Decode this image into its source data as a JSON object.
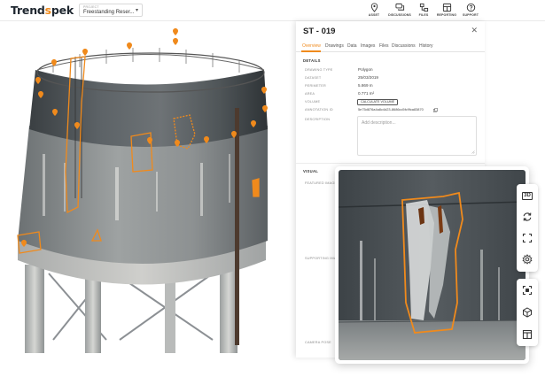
{
  "header": {
    "logo_main": "Trend",
    "logo_accent": "s",
    "logo_tail": "pek",
    "project_caption": "PROJECT",
    "project_value": "Freestanding Reser...",
    "nav": [
      {
        "label": "ASSET",
        "icon": "map-pin-icon"
      },
      {
        "label": "DISCUSSIONS",
        "icon": "chat-icon"
      },
      {
        "label": "FILES",
        "icon": "files-icon"
      },
      {
        "label": "REPORTING",
        "icon": "report-icon"
      },
      {
        "label": "SUPPORT",
        "icon": "help-icon"
      }
    ]
  },
  "panel": {
    "title": "ST - 019",
    "tabs": [
      "Overview",
      "Drawings",
      "Data",
      "Images",
      "Files",
      "Discussions",
      "History"
    ],
    "active_tab": "Overview",
    "details_heading": "DETAILS",
    "rows": [
      {
        "key": "DRAWING TYPE",
        "value": "Polygon"
      },
      {
        "key": "DATASET",
        "value": "25/03/2019"
      },
      {
        "key": "PERIMETER",
        "value": "5.869 m"
      },
      {
        "key": "AREA",
        "value": "0.771 m²"
      },
      {
        "key": "VOLUME",
        "value": ""
      },
      {
        "key": "ANNOTATION ID",
        "value": "5e75d876a4a8c4d23-8686cc5fc9fca83870"
      }
    ],
    "calculate_label": "CALCULATE VOLUME",
    "description_label": "DESCRIPTION",
    "description_placeholder": "Add description...",
    "visual_heading": "VISUAL",
    "featured_label": "FEATURED IMAGE",
    "supporting_label": "SUPPORTING IMAG",
    "camera_label": "CAMERA POSE"
  },
  "toolbars": {
    "top": [
      {
        "name": "3d-view-icon",
        "text": "3D"
      },
      {
        "name": "sync-icon",
        "text": ""
      },
      {
        "name": "fullscreen-icon",
        "text": ""
      },
      {
        "name": "settings-icon",
        "text": ""
      }
    ],
    "bottom": [
      {
        "name": "focus-icon"
      },
      {
        "name": "cube-icon"
      },
      {
        "name": "split-view-icon"
      }
    ]
  },
  "colors": {
    "accent": "#f08a1c",
    "dark": "#1f2730"
  }
}
